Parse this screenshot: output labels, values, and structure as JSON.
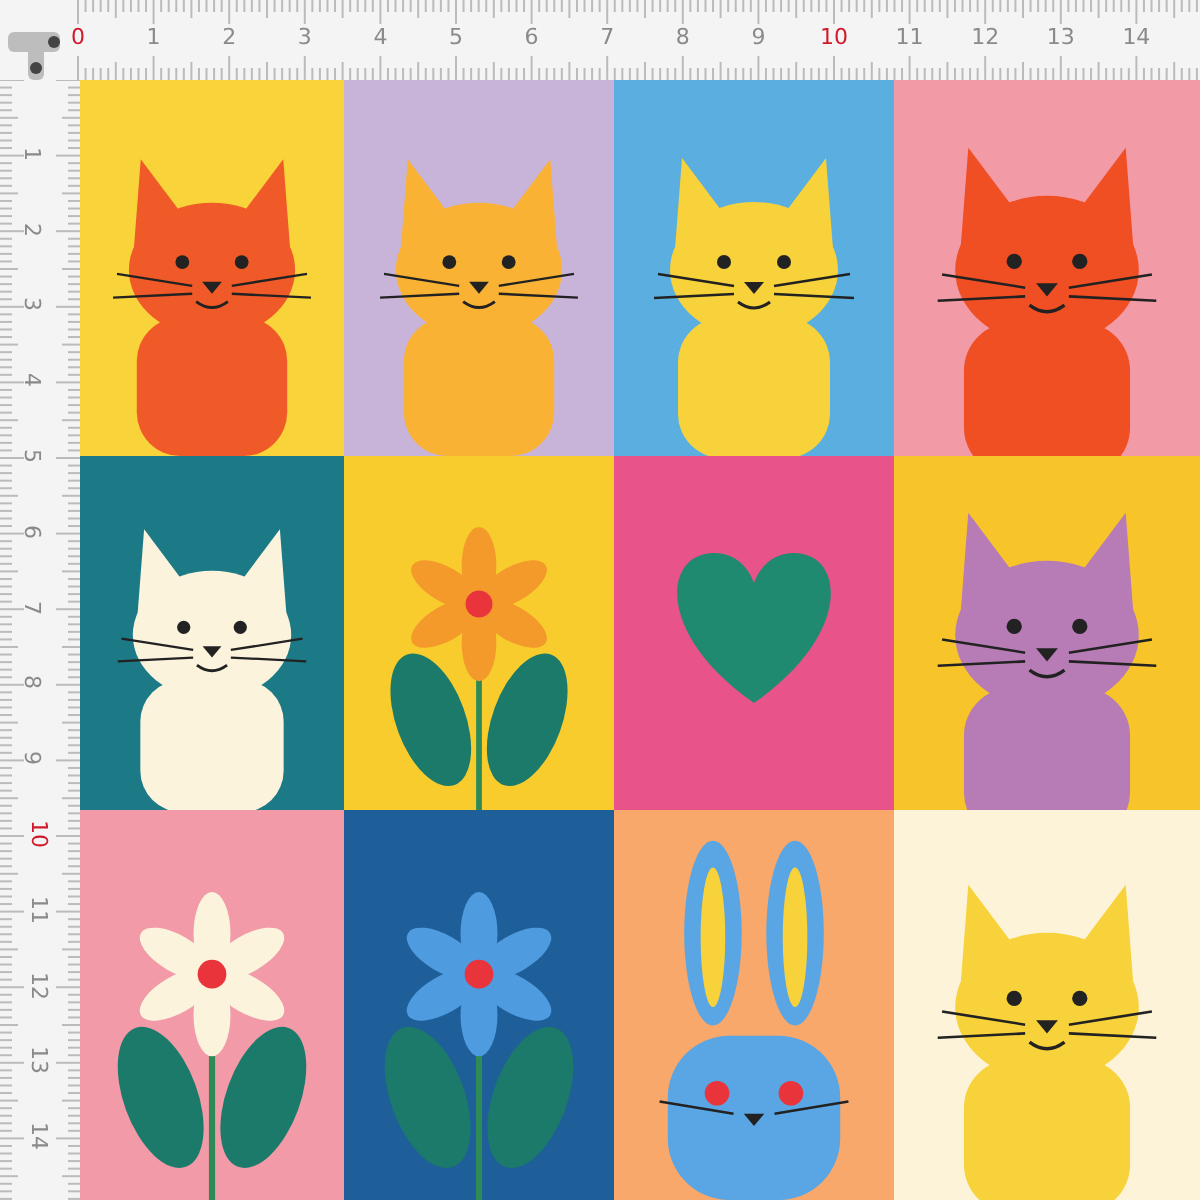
{
  "ruler_top": {
    "labels": [
      {
        "text": "0",
        "kind": "major"
      },
      {
        "text": "1",
        "kind": "minor"
      },
      {
        "text": "2",
        "kind": "minor"
      },
      {
        "text": "3",
        "kind": "minor"
      },
      {
        "text": "4",
        "kind": "minor"
      },
      {
        "text": "5",
        "kind": "minor"
      },
      {
        "text": "6",
        "kind": "minor"
      },
      {
        "text": "7",
        "kind": "minor"
      },
      {
        "text": "8",
        "kind": "minor"
      },
      {
        "text": "9",
        "kind": "minor"
      },
      {
        "text": "10",
        "kind": "major"
      },
      {
        "text": "11",
        "kind": "minor"
      },
      {
        "text": "12",
        "kind": "minor"
      },
      {
        "text": "13",
        "kind": "minor"
      },
      {
        "text": "14",
        "kind": "minor"
      }
    ]
  },
  "ruler_left": {
    "labels": [
      {
        "text": "1",
        "kind": "minor"
      },
      {
        "text": "2",
        "kind": "minor"
      },
      {
        "text": "3",
        "kind": "minor"
      },
      {
        "text": "4",
        "kind": "minor"
      },
      {
        "text": "5",
        "kind": "minor"
      },
      {
        "text": "6",
        "kind": "minor"
      },
      {
        "text": "7",
        "kind": "minor"
      },
      {
        "text": "8",
        "kind": "minor"
      },
      {
        "text": "9",
        "kind": "minor"
      },
      {
        "text": "10",
        "kind": "major"
      },
      {
        "text": "11",
        "kind": "minor"
      },
      {
        "text": "12",
        "kind": "minor"
      },
      {
        "text": "13",
        "kind": "minor"
      },
      {
        "text": "14",
        "kind": "minor"
      }
    ]
  },
  "tiles": [
    {
      "kind": "cat",
      "color": "#f9d33a"
    },
    {
      "kind": "cat",
      "color": "#c8b4d9"
    },
    {
      "kind": "cat",
      "color": "#5aaee0"
    },
    {
      "kind": "cat",
      "color": "#f29aa5"
    },
    {
      "kind": "cat",
      "color": "#1c7a86"
    },
    {
      "kind": "flower",
      "color": "#f8cc2c"
    },
    {
      "kind": "heart",
      "color": "#e8548a"
    },
    {
      "kind": "cat",
      "color": "#f7c52a"
    },
    {
      "kind": "flower",
      "color": "#f29aa8"
    },
    {
      "kind": "flower",
      "color": "#1e5f99"
    },
    {
      "kind": "bunny",
      "color": "#f7a86a"
    },
    {
      "kind": "cat",
      "color": "#fdf3d8"
    }
  ]
}
